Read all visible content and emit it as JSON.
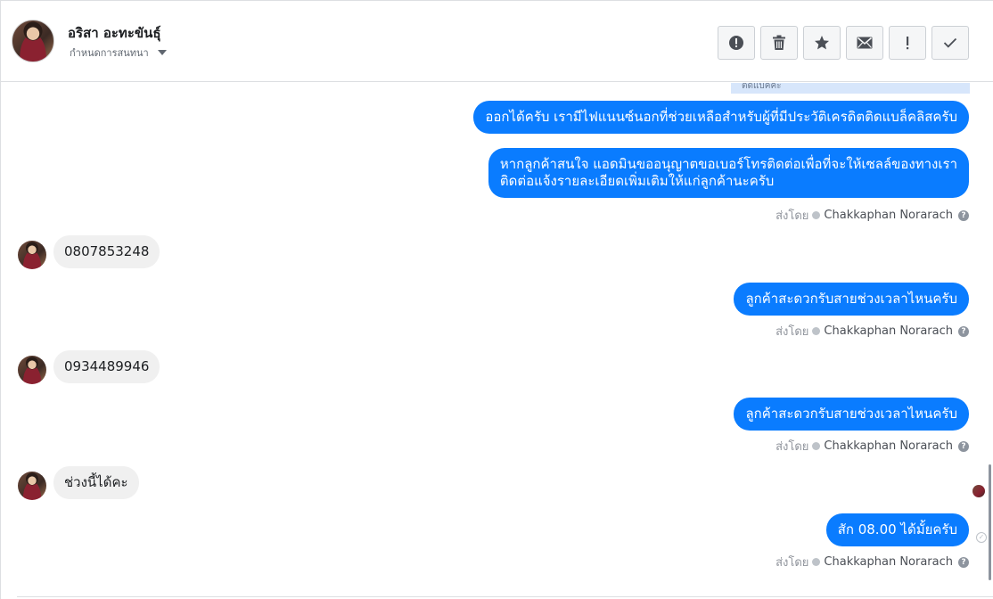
{
  "header": {
    "contact_name": "อริสา อะทะขันธุ์",
    "conversation_setting": "กำหนดการสนทนา",
    "toolbar_icons": [
      "alert-circle-icon",
      "trash-icon",
      "star-icon",
      "mail-icon",
      "exclamation-icon",
      "check-icon"
    ]
  },
  "thread": {
    "partial_card_text": "ติดแบคคะ",
    "messages": [
      {
        "from": "page",
        "text": "ออกได้ครับ เรามีไฟแนนซ์นอกที่ช่วยเหลือสำหรับผู้ที่มีประวัติเครดิตติดแบล็คลิสครับ"
      },
      {
        "from": "page",
        "text_line1": "หากลูกค้าสนใจ แอดมินขออนุญาตขอเบอร์โทรติดต่อเพื่อที่จะให้เซลล์ของทางเรา",
        "text_line2": "ติดต่อแจ้งรายละเอียดเพิ่มเติมให้แก่ลูกค้านะครับ"
      },
      {
        "from": "customer",
        "text": "0807853248"
      },
      {
        "from": "page",
        "text": "ลูกค้าสะดวกรับสายช่วงเวลาไหนครับ"
      },
      {
        "from": "customer",
        "text": "0934489946"
      },
      {
        "from": "page",
        "text": "ลูกค้าสะดวกรับสายช่วงเวลาไหนครับ"
      },
      {
        "from": "customer",
        "text": "ช่วงนี้ได้คะ"
      },
      {
        "from": "page",
        "text": "สัก 08.00 ได้มั้ยครับ"
      }
    ],
    "sent_by_label": "ส่งโดย",
    "agent_name": "Chakkaphan Norarach",
    "help_glyph": "?"
  }
}
